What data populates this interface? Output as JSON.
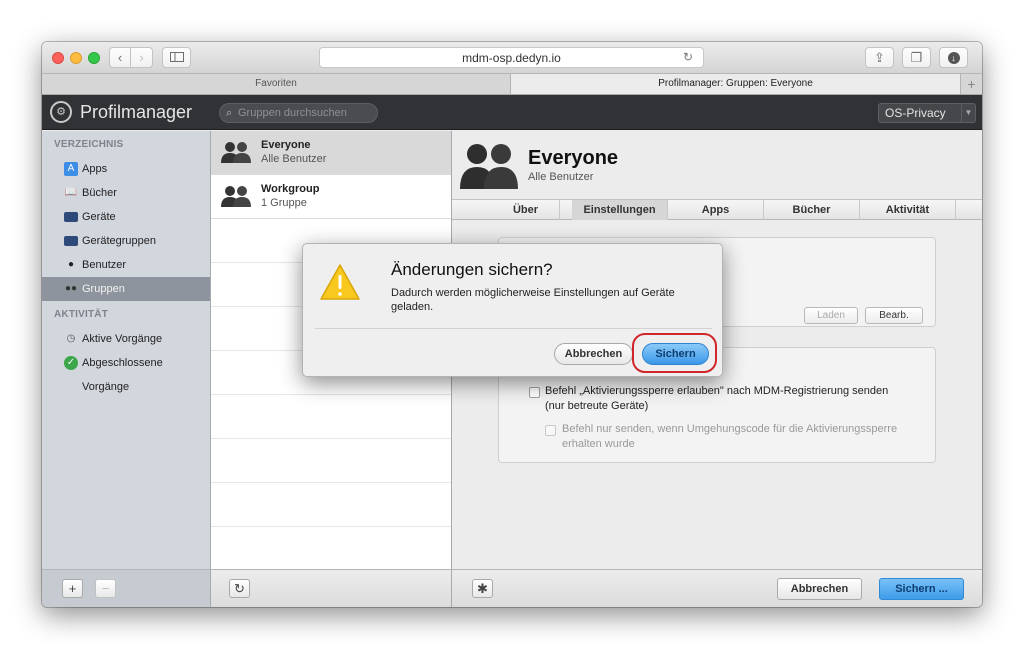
{
  "browser": {
    "url": "mdm-osp.dedyn.io",
    "tabs": [
      {
        "label": "Favoriten"
      },
      {
        "label": "Profilmanager: Gruppen: Everyone"
      }
    ]
  },
  "app": {
    "title": "Profilmanager",
    "search_placeholder": "Gruppen durchsuchen",
    "org_select": "OS-Privacy"
  },
  "sidebar": {
    "section_directory": "VERZEICHNIS",
    "items": [
      {
        "label": "Apps",
        "icon": "apps-icon"
      },
      {
        "label": "Bücher",
        "icon": "book-icon"
      },
      {
        "label": "Geräte",
        "icon": "device-icon"
      },
      {
        "label": "Gerätegruppen",
        "icon": "device-group-icon"
      },
      {
        "label": "Benutzer",
        "icon": "user-icon"
      },
      {
        "label": "Gruppen",
        "icon": "group-icon"
      }
    ],
    "section_activity": "AKTIVITÄT",
    "activity_items": [
      {
        "label": "Aktive Vorgänge",
        "icon": "clock-icon"
      },
      {
        "label": "Abgeschlossene Vorgänge",
        "icon": "checkmark-icon"
      }
    ]
  },
  "groups": [
    {
      "name": "Everyone",
      "sub": "Alle Benutzer"
    },
    {
      "name": "Workgroup",
      "sub": "1 Gruppe"
    }
  ],
  "detail": {
    "title": "Everyone",
    "subtitle": "Alle Benutzer",
    "tabs": [
      "Über",
      "Einstellungen",
      "Apps",
      "Bücher",
      "Aktivität"
    ],
    "active_tab": "Einstellungen",
    "load_button": "Laden",
    "edit_button": "Bearb.",
    "checkbox1_label": "Befehl „Aktivierungssperre erlauben\" nach MDM-Registrierung senden (nur betreute Geräte)",
    "checkbox2_label": "Befehl nur senden, wenn Umgehungscode für die Aktivierungssperre erhalten wurde"
  },
  "footer": {
    "cancel": "Abbrechen",
    "save": "Sichern ..."
  },
  "dialog": {
    "title": "Änderungen sichern?",
    "message": "Dadurch werden möglicherweise Einstellungen auf Geräte geladen.",
    "cancel": "Abbrechen",
    "save": "Sichern"
  },
  "colors": {
    "highlight_ring": "#d0262a",
    "primary_button": "#3e9ce9",
    "app_header": "#303236"
  }
}
